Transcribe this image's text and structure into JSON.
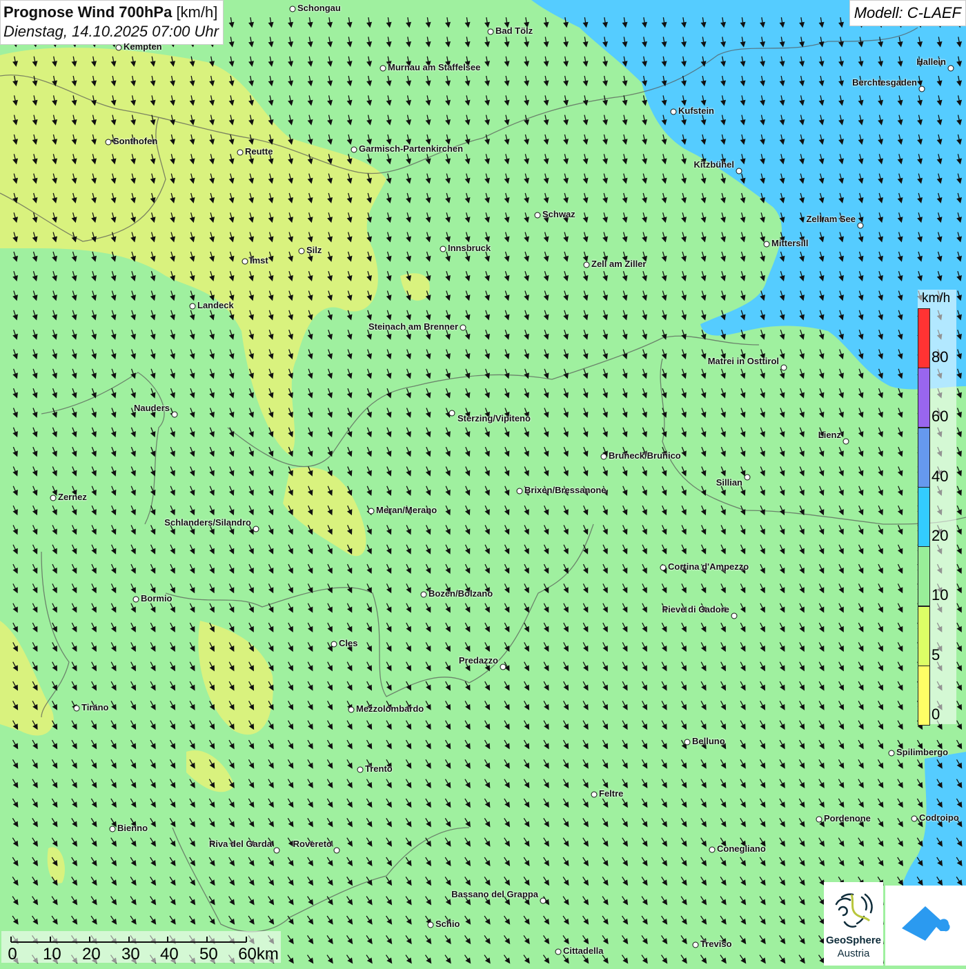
{
  "title": {
    "main": "Prognose Wind 700hPa",
    "unit": "[km/h]",
    "datetime": "Dienstag, 14.10.2025 07:00 Uhr"
  },
  "model": "Modell: C-LAEF",
  "legend": {
    "unit": "km/h",
    "bands": [
      {
        "label": "80",
        "color": "#ff3333"
      },
      {
        "label": "60",
        "color": "#9966ee"
      },
      {
        "label": "40",
        "color": "#6699ee"
      },
      {
        "label": "20",
        "color": "#33ccff"
      },
      {
        "label": "10",
        "color": "#99ee99"
      },
      {
        "label": "5",
        "color": "#ddff66"
      },
      {
        "label": "0",
        "color": "#ffff66"
      }
    ]
  },
  "scale": {
    "labels": [
      "0",
      "10",
      "20",
      "30",
      "40",
      "50",
      "60km"
    ]
  },
  "logos": {
    "geosphere_line1": "GeoSphere",
    "geosphere_line2": "Austria"
  },
  "colors": {
    "field_green": "#9ff09f",
    "field_yellow": "#d9f27e",
    "field_cyan": "#55ccff"
  },
  "wind_direction_deg": 155,
  "cities": [
    "Schongau",
    "Bad Tölz",
    "Kempten",
    "Murnau am Staffelsee",
    "Hallein",
    "Berchtesgaden",
    "Kufstein",
    "Sonthofen",
    "Reutte",
    "Garmisch-Partenkirchen",
    "Kitzbühel",
    "Schwaz",
    "Zell am See",
    "Mittersill",
    "Innsbruck",
    "Silz",
    "Imst",
    "Zell am Ziller",
    "Landeck",
    "Steinach am Brenner",
    "Matrei in Osttirol",
    "Nauders",
    "Sterzing/Vipiteno",
    "Lienz",
    "Bruneck/Brunico",
    "Sillian",
    "Brixen/Bressanone",
    "Zernez",
    "Meran/Merano",
    "Schlanders/Silandro",
    "Cortina d'Ampezzo",
    "Bozen/Bolzano",
    "Bormio",
    "Pieve di Cadore",
    "Cles",
    "Predazzo",
    "Tirano",
    "Mezzolombardo",
    "Belluno",
    "Spilimbergo",
    "Trento",
    "Feltre",
    "Pordenone",
    "Codroipo",
    "Bienno",
    "Riva del Garda",
    "Rovereto",
    "Conegliano",
    "Bassano del Grappa",
    "Schio",
    "Treviso",
    "Cittadella"
  ]
}
